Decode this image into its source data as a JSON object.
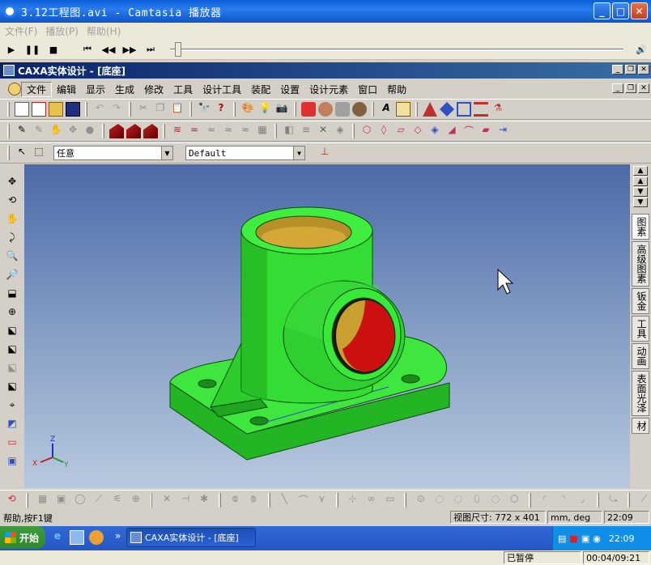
{
  "player": {
    "title": "3.12工程图.avi - Camtasia 播放器",
    "menu": [
      "文件(F)",
      "播放(P)",
      "帮助(H)"
    ],
    "status": "已暂停",
    "time": "00:04/09:21"
  },
  "caxa": {
    "title": "CAXA实体设计 - [底座]",
    "menu": [
      "文件",
      "编辑",
      "显示",
      "生成",
      "修改",
      "工具",
      "设计工具",
      "装配",
      "设置",
      "设计元素",
      "窗口",
      "帮助"
    ],
    "filter_combo": "任意",
    "style_combo": "Default",
    "right_tabs": [
      "图素",
      "高级图素",
      "钣金",
      "工具",
      "动画",
      "表面光泽",
      "材"
    ],
    "status_help": "帮助,按F1键",
    "status_view_size": "视图尺寸: 772 x 401",
    "status_units": "mm, deg",
    "status_time": "22:09"
  },
  "taskbar": {
    "start_label": "开始",
    "task_label": "CAXA实体设计 - [底座]",
    "clock": "22:09"
  },
  "colors": {
    "part_green": "#33e633",
    "bore_gold": "#c8a030",
    "bore_red": "#cc1010"
  }
}
